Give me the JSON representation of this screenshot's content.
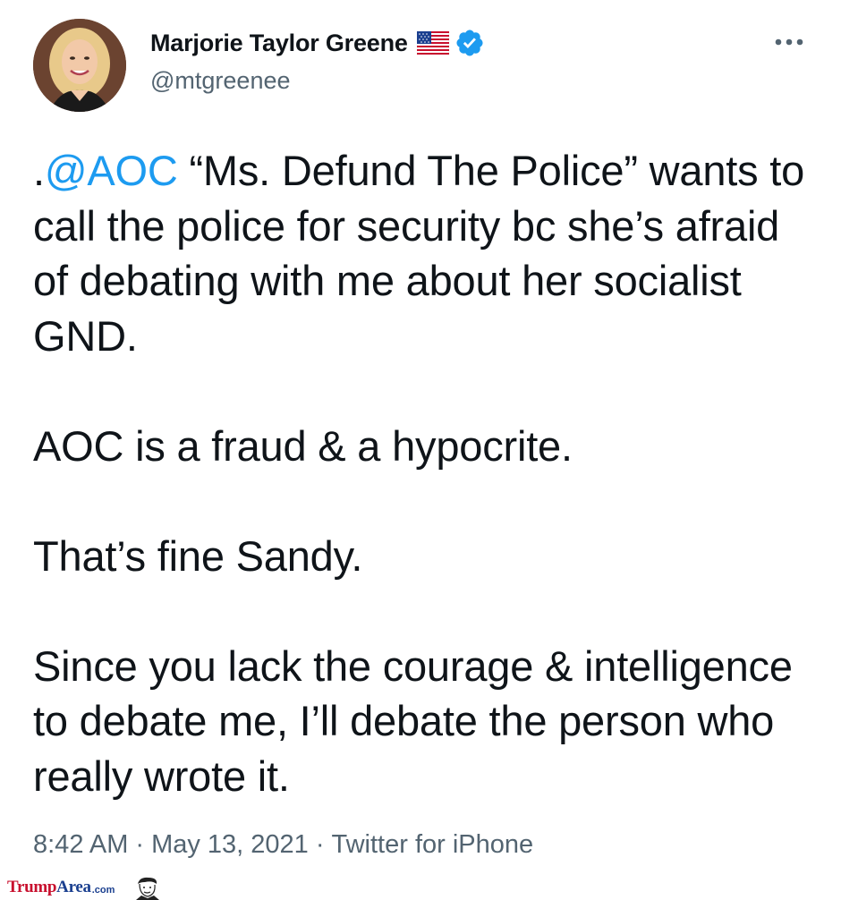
{
  "author": {
    "display_name": "Marjorie Taylor Greene",
    "handle": "@mtgreenee",
    "flag_icon": "us-flag-icon",
    "verified_icon": "verified-badge-icon",
    "verified_color": "#1d9bf0"
  },
  "menu": {
    "icon": "more-options-icon"
  },
  "tweet": {
    "line1_prefix": ".",
    "mention": "@AOC",
    "line1_rest": " “Ms. Defund The Police” wants to call the police for security bc she’s afraid of debating with me about her socialist GND.",
    "paragraph2": "AOC is a fraud & a hypocrite.",
    "paragraph3": "That’s fine Sandy.",
    "paragraph4": "Since you lack the courage & intelligence to debate me, I’ll debate the person who really wrote it."
  },
  "meta": {
    "time": "8:42 AM",
    "separator": "·",
    "date": "May 13, 2021",
    "source": "Twitter for iPhone"
  },
  "watermark": {
    "brand_part1": "Trump",
    "brand_part2": "Area",
    "brand_suffix": ".com",
    "icon": "caricature-face-icon"
  },
  "colors": {
    "text": "#0f1419",
    "secondary": "#536471",
    "link": "#1d9bf0",
    "watermark_red": "#c8102e",
    "watermark_blue": "#1a3f8f"
  }
}
